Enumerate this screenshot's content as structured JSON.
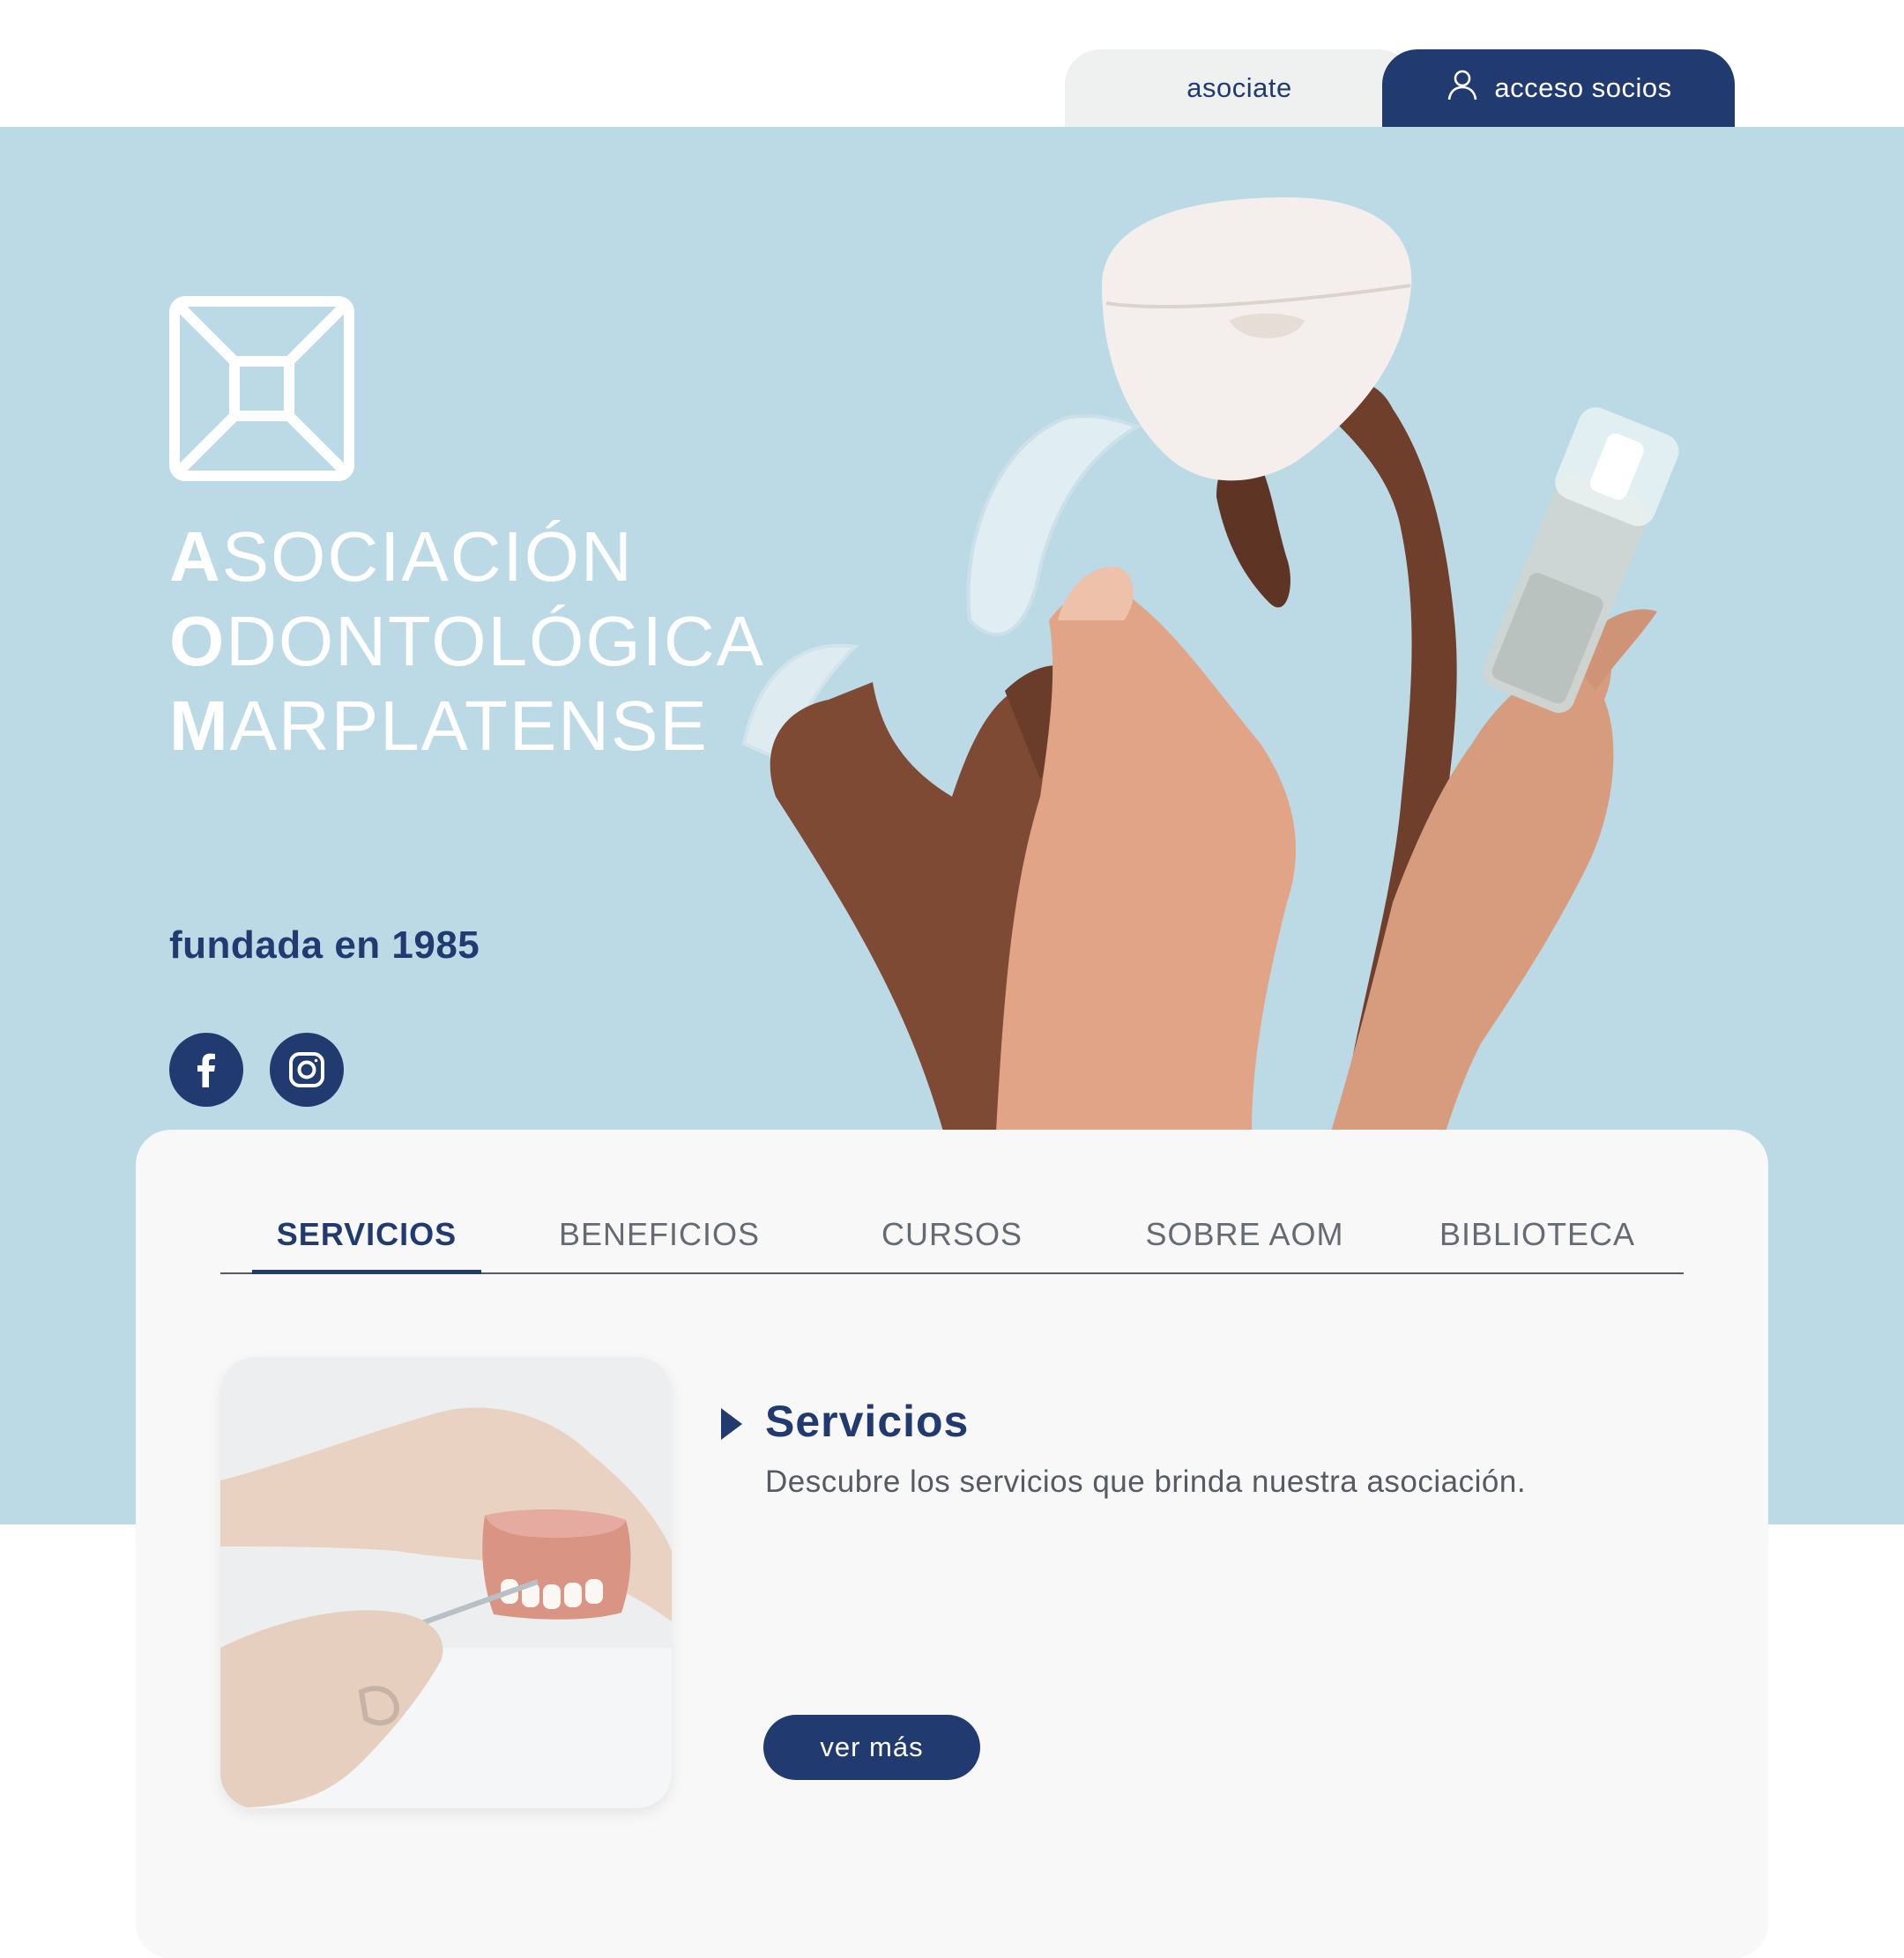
{
  "header": {
    "asociate_label": "asociate",
    "acceso_label": "acceso socios",
    "acceso_icon": "user-icon"
  },
  "hero": {
    "title_lines": [
      {
        "initial": "A",
        "rest": "SOCIACIÓN"
      },
      {
        "initial": "O",
        "rest": "DONTOLÓGICA"
      },
      {
        "initial": "M",
        "rest": "ARPLATENSE"
      }
    ],
    "founded": "fundada en 1985",
    "social": [
      "facebook-icon",
      "instagram-icon"
    ]
  },
  "tabs": [
    {
      "label": "SERVICIOS",
      "active": true
    },
    {
      "label": "BENEFICIOS",
      "active": false
    },
    {
      "label": "CURSOS",
      "active": false
    },
    {
      "label": "SOBRE AOM",
      "active": false
    },
    {
      "label": "BIBLIOTECA",
      "active": false
    }
  ],
  "service": {
    "title": "Servicios",
    "description": "Descubre los servicios que brinda nuestra asociación.",
    "button_label": "ver más"
  },
  "colors": {
    "brand_navy": "#213a70",
    "hero_blue": "#bcd9e6",
    "card_bg": "#f8f8f8"
  }
}
